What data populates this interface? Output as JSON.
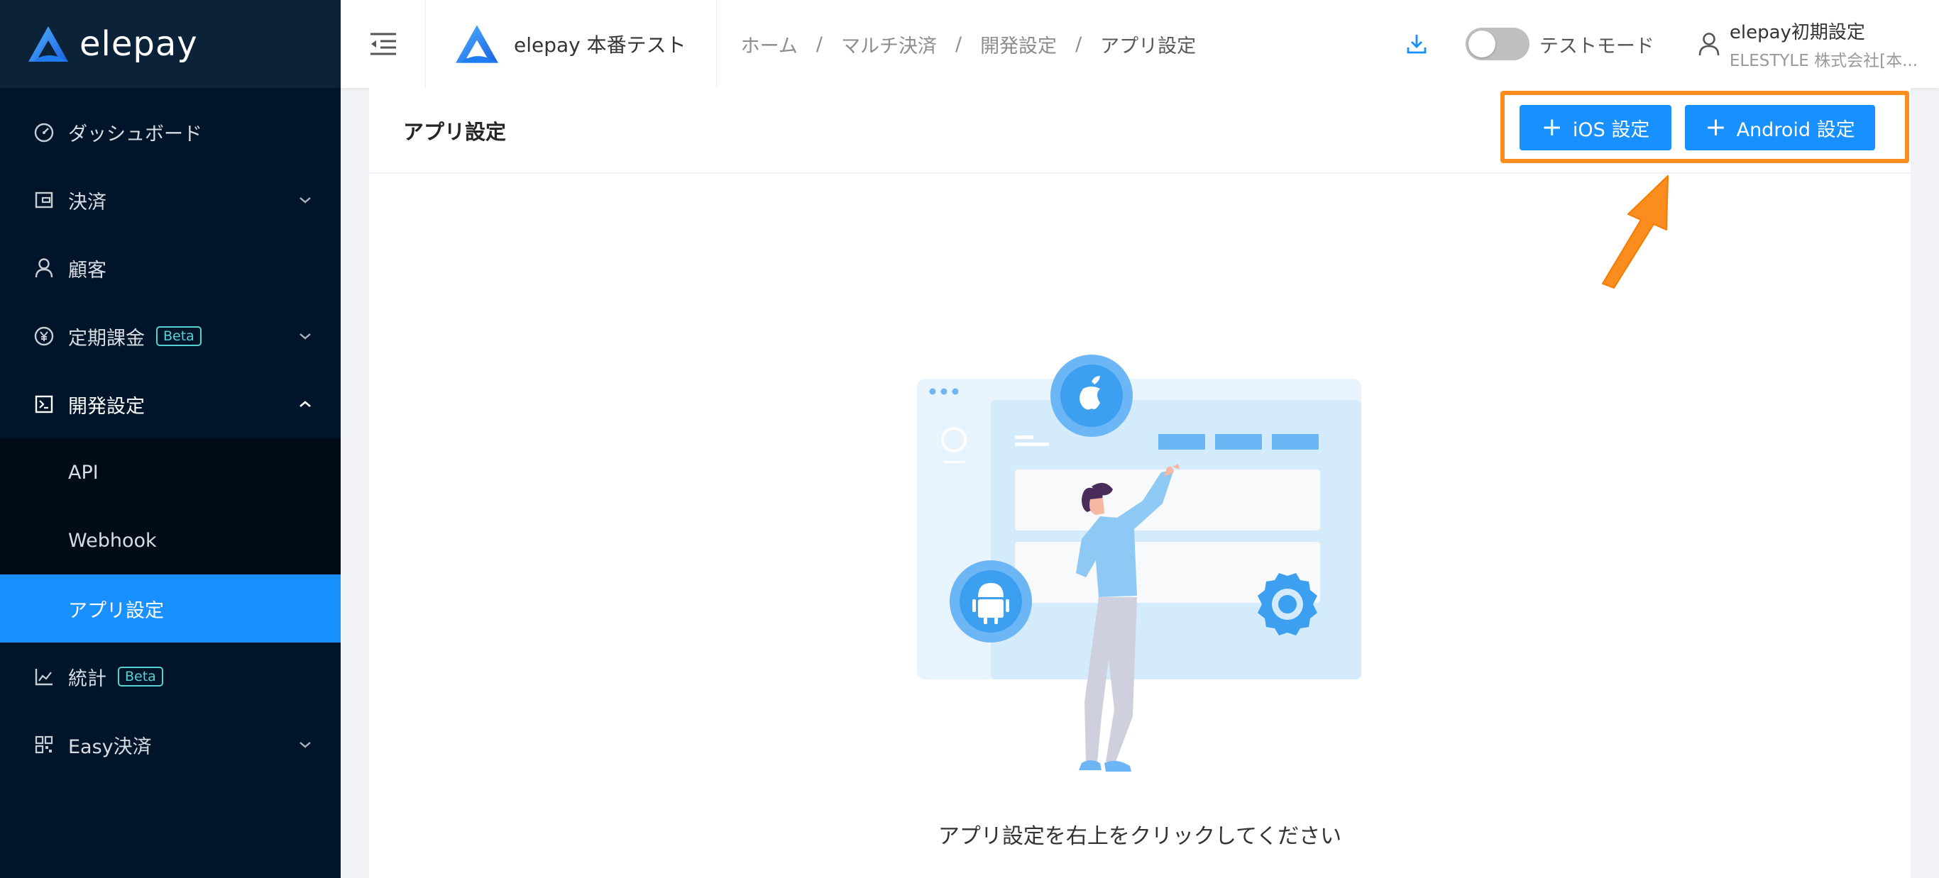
{
  "brand": {
    "name": "elepay"
  },
  "sidebar": {
    "items": [
      {
        "label": "ダッシュボード",
        "icon": "dashboard-icon"
      },
      {
        "label": "決済",
        "icon": "wallet-icon",
        "has_children": true
      },
      {
        "label": "顧客",
        "icon": "user-icon"
      },
      {
        "label": "定期課金",
        "icon": "yen-cycle-icon",
        "badge": "Beta",
        "has_children": true
      },
      {
        "label": "開発設定",
        "icon": "terminal-icon",
        "expanded": true
      },
      {
        "label": "統計",
        "icon": "line-chart-icon",
        "badge": "Beta"
      },
      {
        "label": "Easy決済",
        "icon": "qrcode-icon",
        "has_children": true
      }
    ],
    "submenu": [
      {
        "label": "API"
      },
      {
        "label": "Webhook"
      },
      {
        "label": "アプリ設定",
        "active": true
      }
    ]
  },
  "header": {
    "project_name": "elepay 本番テスト",
    "breadcrumb": [
      "ホーム",
      "マルチ決済",
      "開発設定",
      "アプリ設定"
    ],
    "breadcrumb_sep": "/",
    "test_mode_label": "テストモード",
    "test_mode_on": false,
    "user_name": "elepay初期設定",
    "user_company": "ELESTYLE 株式会社[本..."
  },
  "page": {
    "title": "アプリ設定",
    "ios_button": "iOS 設定",
    "android_button": "Android 設定",
    "plus": "+",
    "empty_message": "アプリ設定を右上をクリックしてください"
  },
  "colors": {
    "primary": "#1890ff",
    "sidebar_bg": "#001529",
    "highlight": "#fb8c1e",
    "beta": "#53d1d3"
  }
}
